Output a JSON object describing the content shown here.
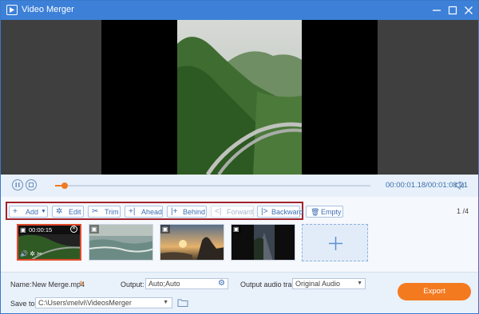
{
  "window": {
    "title": "Video Merger"
  },
  "playback": {
    "current_time": "00:00:01.18",
    "total_time": "00:01:08.21",
    "timecode": "00:00:01.18/00:01:08.21",
    "progress": 0.03
  },
  "toolbar": {
    "add": "Add",
    "edit": "Edit",
    "trim": "Trim",
    "ahead": "Ahead",
    "behind": "Behind",
    "forward": "Forward",
    "backward": "Backward",
    "empty": "Empty"
  },
  "pager": {
    "current": "1",
    "total": "4"
  },
  "clips": [
    {
      "duration": "00:00:15",
      "selected": true,
      "scene": "drone-mountain-road"
    },
    {
      "duration": "",
      "selected": false,
      "scene": "ocean-waves"
    },
    {
      "duration": "",
      "selected": false,
      "scene": "sunset-rocky-coast"
    },
    {
      "duration": "",
      "selected": false,
      "scene": "dark-road"
    }
  ],
  "output": {
    "name_label": "Name:",
    "name_value": "New Merge.mp4",
    "output_label": "Output:",
    "output_value": "Auto;Auto",
    "audio_label": "Output audio track:",
    "audio_value": "Original Audio",
    "save_label": "Save to:",
    "save_path": "C:\\Users\\melvi\\VideosMerger",
    "export": "Export"
  },
  "colors": {
    "accent": "#3c80d8",
    "export": "#f47a20",
    "highlight_box": "#a3232c",
    "progress": "#f07a22"
  }
}
